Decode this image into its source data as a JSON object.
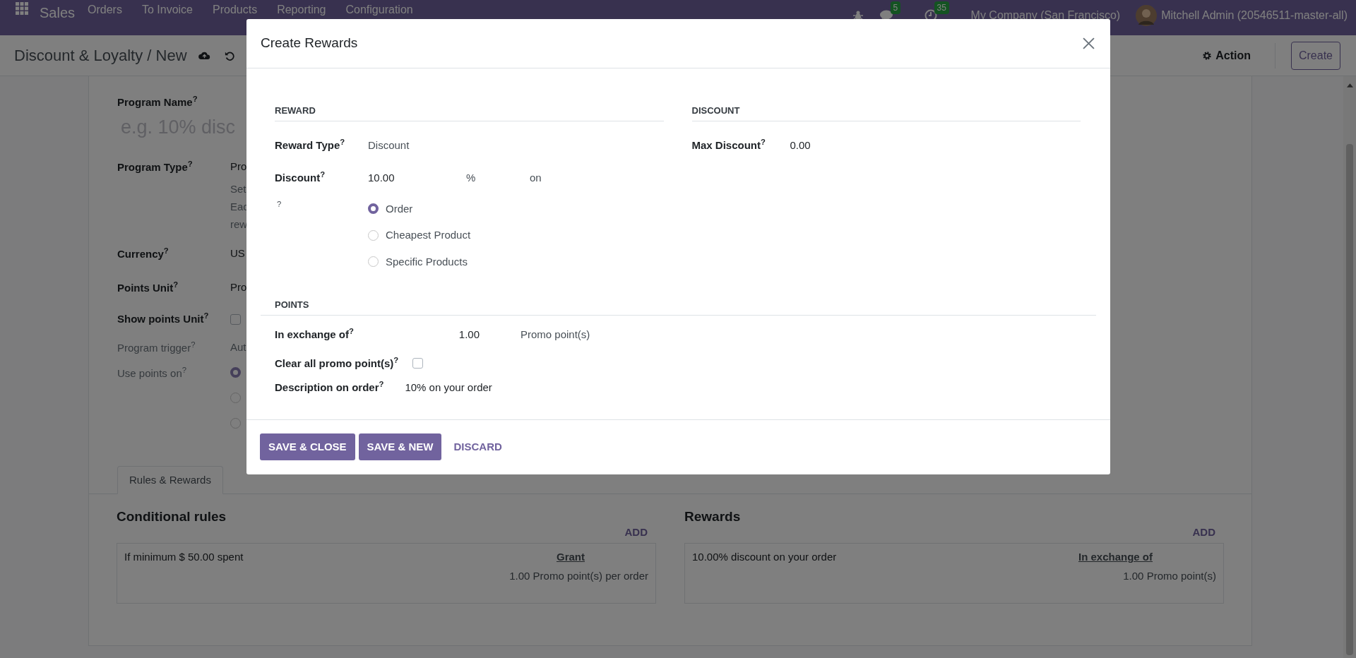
{
  "navbar": {
    "app": "Sales",
    "menu": [
      "Orders",
      "To Invoice",
      "Products",
      "Reporting",
      "Configuration"
    ],
    "messages_badge": "5",
    "activities_badge": "35",
    "company": "My Company (San Francisco)",
    "user": "Mitchell Admin (20546511-master-all)"
  },
  "control_panel": {
    "breadcrumb": "Discount & Loyalty / New",
    "action": "Action",
    "create": "Create"
  },
  "form": {
    "program_name_label": "Program Name$^{?}$",
    "program_name_placeholder": "e.g. 10% disc",
    "fields": [
      {
        "kind": "text",
        "label": "Program Type$^{?}$",
        "value": "Pro",
        "muted": false,
        "notes": [
          "Set",
          "Eac",
          "rew"
        ]
      },
      {
        "kind": "text",
        "label": "Currency$^{?}$",
        "value": "US",
        "muted": false
      },
      {
        "kind": "text",
        "label": "Points Unit$^{?}$",
        "value": "Pro",
        "muted": false
      },
      {
        "kind": "checkbox",
        "label": "Show points Unit$^{?}$",
        "checked": false,
        "muted": false
      },
      {
        "kind": "text",
        "label": "Program trigger$^{?}$",
        "value": "Aut",
        "muted": true
      },
      {
        "kind": "radios",
        "label": "Use points on$^{?}$",
        "muted": true,
        "options": [
          {
            "selected": true
          },
          {
            "selected": false
          },
          {
            "selected": false
          }
        ]
      }
    ]
  },
  "tabs": [
    {
      "label": "Rules & Rewards",
      "selected": true
    }
  ],
  "panels": [
    {
      "title": "Conditional rules",
      "add": "ADD",
      "card": {
        "text": "If minimum $ 50.00 spent",
        "link": "Grant",
        "detail": "1.00 Promo point(s) per order"
      }
    },
    {
      "title": "Rewards",
      "add": "ADD",
      "card": {
        "text": "10.00% discount on your order",
        "link": "In exchange of",
        "detail": "1.00 Promo point(s)"
      }
    }
  ],
  "dialog": {
    "title": "Create Rewards",
    "reward": {
      "heading": "REWARD",
      "reward_type": {
        "label": "Reward Type$^{?}$",
        "value": "Discount"
      },
      "discount": {
        "label": "Discount$^{?}$",
        "value": "10.00",
        "unit": "%",
        "suffix": "on"
      },
      "apply_on": {
        "label": "$^{?}$",
        "options": [
          {
            "label": "Order",
            "selected": true
          },
          {
            "label": "Cheapest Product",
            "selected": false
          },
          {
            "label": "Specific Products",
            "selected": false
          }
        ]
      }
    },
    "discount": {
      "heading": "DISCOUNT",
      "max_discount": {
        "label": "Max Discount$^{?}$",
        "value": "0.00"
      }
    },
    "points": {
      "heading": "POINTS",
      "exchange": {
        "label": "In exchange of$^{?}$",
        "value": "1.00",
        "unit": "Promo point(s)"
      },
      "clear": {
        "label": "Clear all promo point(s)$^{?}$",
        "checked": false
      },
      "description": {
        "label": "Description on order$^{?}$",
        "value": "10% on your order"
      }
    },
    "buttons": [
      {
        "label": "SAVE & CLOSE",
        "kind": "primary"
      },
      {
        "label": "SAVE & NEW",
        "kind": "primary"
      },
      {
        "label": "DISCARD",
        "kind": "link"
      }
    ]
  }
}
